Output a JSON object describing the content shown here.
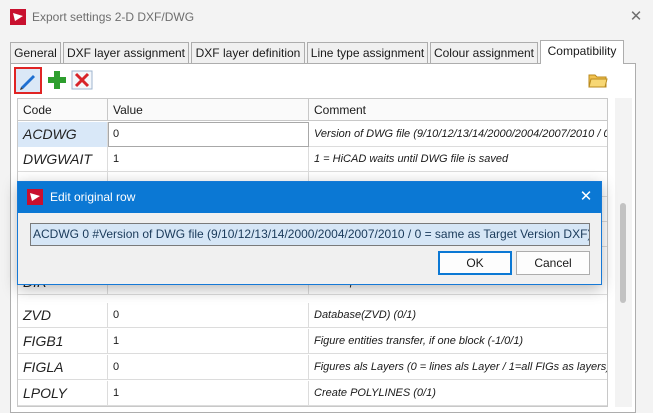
{
  "window": {
    "title": "Export settings 2-D DXF/DWG",
    "close_glyph": "✕"
  },
  "tabs": [
    {
      "label": "General"
    },
    {
      "label": "DXF layer assignment"
    },
    {
      "label": "DXF layer definition"
    },
    {
      "label": "Line type assignment"
    },
    {
      "label": "Colour assignment"
    },
    {
      "label": "Compatibility",
      "active": true
    }
  ],
  "toolbar": {
    "edit_icon": "pencil-icon",
    "add_icon": "plus-icon",
    "delete_icon": "delete-x-icon",
    "open_icon": "folder-icon"
  },
  "table": {
    "headers": {
      "code": "Code",
      "value": "Value",
      "comment": "Comment"
    },
    "rows": [
      {
        "code": "ACDWG",
        "value": "0",
        "comment": "Version of DWG file (9/10/12/13/14/2000/2004/2007/2010 / 0 = same as Target Version DXF)",
        "selected": true
      },
      {
        "code": "DWGWAIT",
        "value": "1",
        "comment": "1 = HiCAD waits until DWG file is saved"
      },
      {
        "code": "",
        "value": "",
        "comment": ""
      },
      {
        "code": "",
        "value": "",
        "comment": ""
      },
      {
        "code": "",
        "value": "",
        "comment": ""
      },
      {
        "code": "DIR",
        "value": "",
        "comment": "default path where the file should be saved"
      },
      {
        "code": "ZVD",
        "value": "0",
        "comment": "Database(ZVD) (0/1)"
      },
      {
        "code": "FIGB1",
        "value": "1",
        "comment": "Figure entities transfer, if one block (-1/0/1)"
      },
      {
        "code": "FIGLA",
        "value": "0",
        "comment": "Figures als Layers (0 = lines als Layer / 1=all FIGs as layers)"
      },
      {
        "code": "LPOLY",
        "value": "1",
        "comment": "Create POLYLINES (0/1)"
      }
    ]
  },
  "dialog": {
    "title": "Edit original row",
    "close_glyph": "✕",
    "row_text": "ACDWG  0 #Version of DWG file (9/10/12/13/14/2000/2004/2007/2010 / 0 = same as Target Version DXF)",
    "ok_label": "OK",
    "cancel_label": "Cancel"
  },
  "colors": {
    "accent": "#0b78d4",
    "highlight": "#e02424",
    "selection": "#d9e8f8"
  }
}
